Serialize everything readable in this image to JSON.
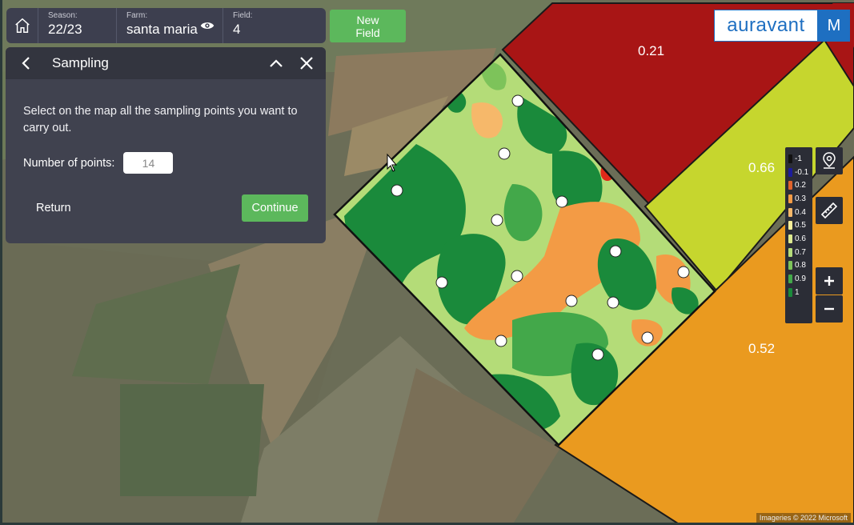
{
  "topbar": {
    "season_label": "Season:",
    "season_value": "22/23",
    "farm_label": "Farm:",
    "farm_value": "santa maria",
    "field_label": "Field:",
    "field_value": "4"
  },
  "new_field_label": "New\nField",
  "panel": {
    "title": "Sampling",
    "instruction": "Select on the map all the sampling points you want to carry out.",
    "points_label": "Number of points:",
    "points_value": "14",
    "return_label": "Return",
    "continue_label": "Continue"
  },
  "brand": {
    "name": "auravant",
    "user_initial": "M"
  },
  "map": {
    "field_values": [
      "0.21",
      "0.66",
      "0.52"
    ],
    "sampling_points_count": 14
  },
  "legend": [
    {
      "value": "-1",
      "color": "#111111"
    },
    {
      "value": "-0.1",
      "color": "#1c1c9a"
    },
    {
      "value": "0.2",
      "color": "#e0632c"
    },
    {
      "value": "0.3",
      "color": "#f39b45"
    },
    {
      "value": "0.4",
      "color": "#f6b86a"
    },
    {
      "value": "0.5",
      "color": "#f8ef9a"
    },
    {
      "value": "0.6",
      "color": "#dce98f"
    },
    {
      "value": "0.7",
      "color": "#b5dc7a"
    },
    {
      "value": "0.8",
      "color": "#7dc35a"
    },
    {
      "value": "0.9",
      "color": "#43a84a"
    },
    {
      "value": "1",
      "color": "#1a8a3b"
    }
  ],
  "attribution": "Imageries © 2022 Microsoft",
  "colors": {
    "accent_green": "#5cb85c",
    "panel_bg": "#40424f",
    "brand_blue": "#1e6fc1"
  },
  "icons": [
    "home-icon",
    "eye-icon",
    "chevron-left-icon",
    "chevron-up-icon",
    "close-icon",
    "map-pin-icon",
    "ruler-icon",
    "zoom-in-icon",
    "zoom-out-icon"
  ]
}
